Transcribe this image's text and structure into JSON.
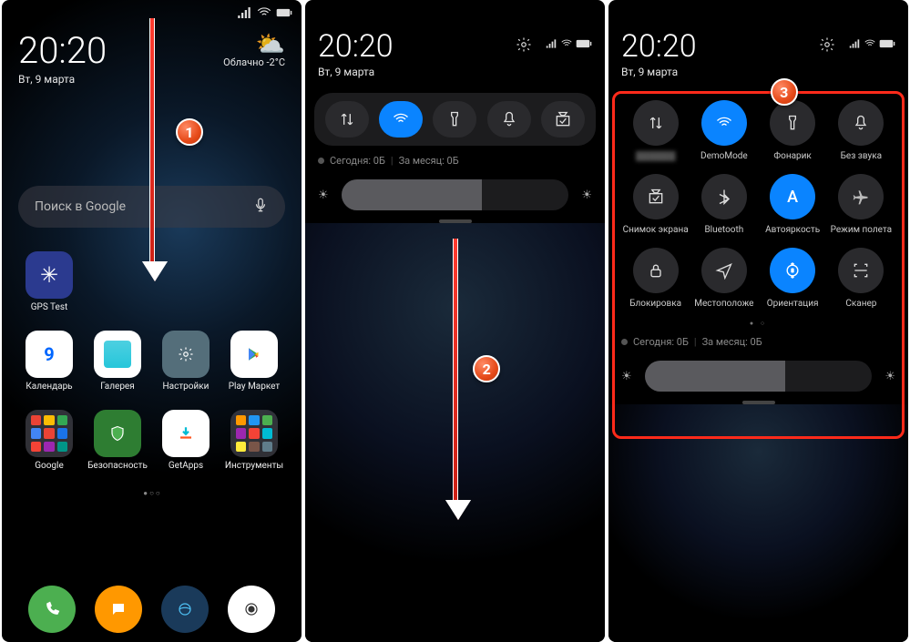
{
  "status": {
    "signal": "●●●",
    "wifi": "wifi",
    "battery": "batt"
  },
  "home": {
    "time": "20:20",
    "date": "Вт, 9 марта",
    "weather_desc": "Облачно",
    "weather_temp": "-2°C",
    "search_placeholder": "Поиск в Google",
    "apps": {
      "gpstest": "GPS Test",
      "calendar": "Календарь",
      "gallery": "Галерея",
      "settings": "Настройки",
      "play": "Play Маркет",
      "google": "Google",
      "security": "Безопасность",
      "getapps": "GetApps",
      "tools": "Инструменты"
    }
  },
  "shade": {
    "time": "20:20",
    "date": "Вт, 9 марта",
    "usage_today": "Сегодня: 0Б",
    "usage_month": "За месяц: 0Б"
  },
  "qs": {
    "data": "",
    "wifi": "DemoMode",
    "flash": "Фонарик",
    "silent": "Без звука",
    "screenshot": "Снимок экрана",
    "bluetooth": "Bluetooth",
    "autobright": "Автояркость",
    "airplane": "Режим полета",
    "lock": "Блокировка",
    "location": "Местоположе",
    "orientation": "Ориентация",
    "scanner": "Сканер",
    "data_blurred": "▓▓▓▓▓▓"
  },
  "steps": {
    "s1": "1",
    "s2": "2",
    "s3": "3"
  }
}
